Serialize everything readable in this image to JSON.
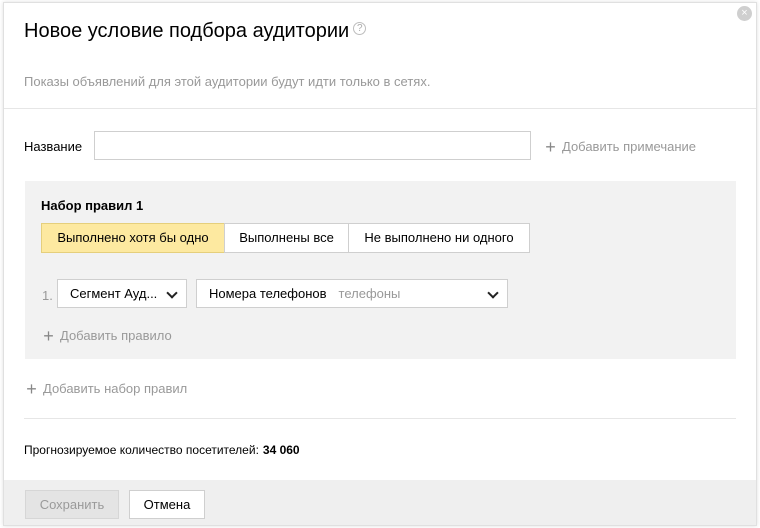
{
  "dialog": {
    "title": "Новое условие подбора аудитории",
    "help_icon": "?",
    "close_icon": "×",
    "subtitle": "Показы объявлений для этой аудитории будут идти только в сетях."
  },
  "name_field": {
    "label": "Название",
    "value": "",
    "placeholder": ""
  },
  "add_note": {
    "icon": "+",
    "label": "Добавить примечание"
  },
  "ruleset": {
    "title": "Набор правил 1",
    "modes": [
      {
        "label": "Выполнено хотя бы одно",
        "active": true
      },
      {
        "label": "Выполнены все",
        "active": false
      },
      {
        "label": "Не выполнено ни одного",
        "active": false
      }
    ],
    "rules": [
      {
        "number": "1.",
        "type_value": "Сегмент Ауд...",
        "segment_value": "Номера телефонов",
        "segment_hint": "телефоны"
      }
    ],
    "add_rule": {
      "icon": "+",
      "label": "Добавить правило"
    }
  },
  "add_ruleset": {
    "icon": "+",
    "label": "Добавить набор правил"
  },
  "forecast": {
    "label": "Прогнозируемое количество посетителей:",
    "value": "34 060"
  },
  "footer": {
    "save_label": "Сохранить",
    "cancel_label": "Отмена"
  },
  "colors": {
    "active_mode": "#fde9a0",
    "ruleset_bg": "#f2f2f2",
    "footer_bg": "#efefef",
    "muted_text": "#999999"
  }
}
